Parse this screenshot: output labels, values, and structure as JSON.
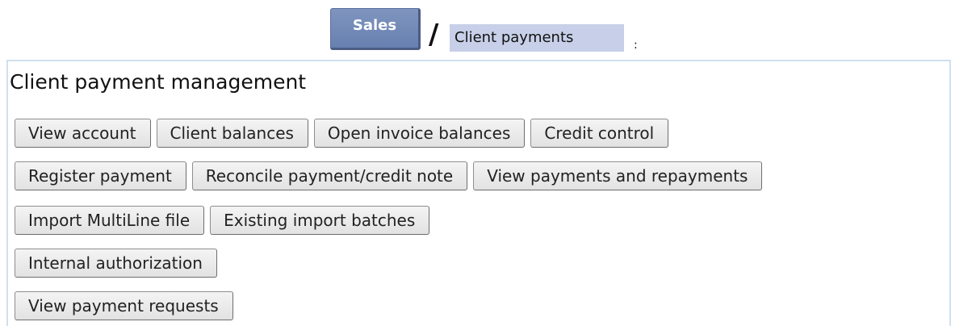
{
  "breadcrumb": {
    "root_label": "Sales",
    "separator": "/",
    "current_label": "Client payments",
    "suffix": ":"
  },
  "panel": {
    "title": "Client payment management",
    "rows": [
      [
        "View account",
        "Client balances",
        "Open invoice balances",
        "Credit control"
      ],
      [
        "Register payment",
        "Reconcile payment/credit note",
        "View payments and repayments"
      ],
      [
        "Import MultiLine file",
        "Existing import batches"
      ],
      [
        "Internal authorization"
      ],
      [
        "View payment requests"
      ]
    ]
  },
  "colors": {
    "breadcrumb_button": "#7489b8",
    "breadcrumb_current_bg": "#c7d0e8",
    "panel_border": "#cfe0f0",
    "button_bg": "#ebebeb"
  }
}
